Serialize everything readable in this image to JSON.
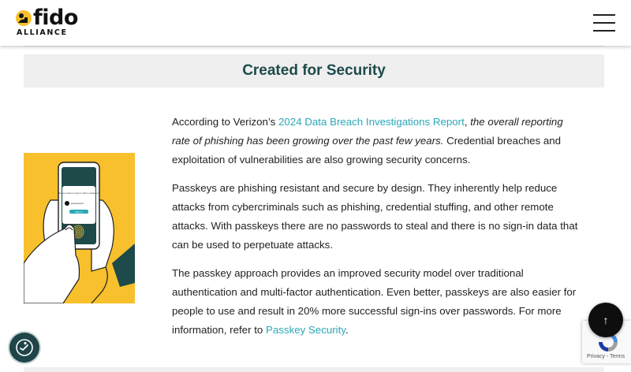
{
  "header": {
    "logo_word": "fido",
    "logo_sub": "ALLIANCE",
    "menu_icon": "hamburger-menu-icon"
  },
  "banner": {
    "title": "Created for Security"
  },
  "illustration": {
    "phone_prompt": "Do you want to sign in with a passkey?",
    "account_label": "janedoe123",
    "sign_in_label": "Sign in",
    "colors": {
      "background": "#f7c02c",
      "phone": "#1e4a4a",
      "sleeve": "#1e4a4a"
    }
  },
  "article": {
    "p1": {
      "prefix": "According to Verizon’s ",
      "link": "2024 Data Breach Investigations Report",
      "comma": ", ",
      "italic": "the overall reporting rate of phishing has been growing over the past few years.",
      "suffix": " Credential breaches and exploitation of vulnerabilities are also growing security concerns."
    },
    "p2": "Passkeys are phishing resistant and secure by design. They inherently help reduce attacks from cybercriminals such as phishing, credential stuffing, and other remote attacks. With passkeys there are no passwords to steal and there is no sign-in data that can be used to perpetuate attacks.",
    "p3": {
      "text": "The passkey approach provides an improved security model over traditional authentication and multi-factor authentication. Even better, passkeys are also easier for people to use and result in  20% more successful sign-ins over passwords. For more information, refer to ",
      "link": "Passkey Security",
      "end": "."
    }
  },
  "widgets": {
    "scroll_top_icon": "↑",
    "recaptcha_text": "Privacy - Terms",
    "accessibility_icon": "accessibility-icon"
  },
  "colors": {
    "accent": "#2aa8b8",
    "heading": "#1e4a4a",
    "banner_bg": "#efefef"
  }
}
